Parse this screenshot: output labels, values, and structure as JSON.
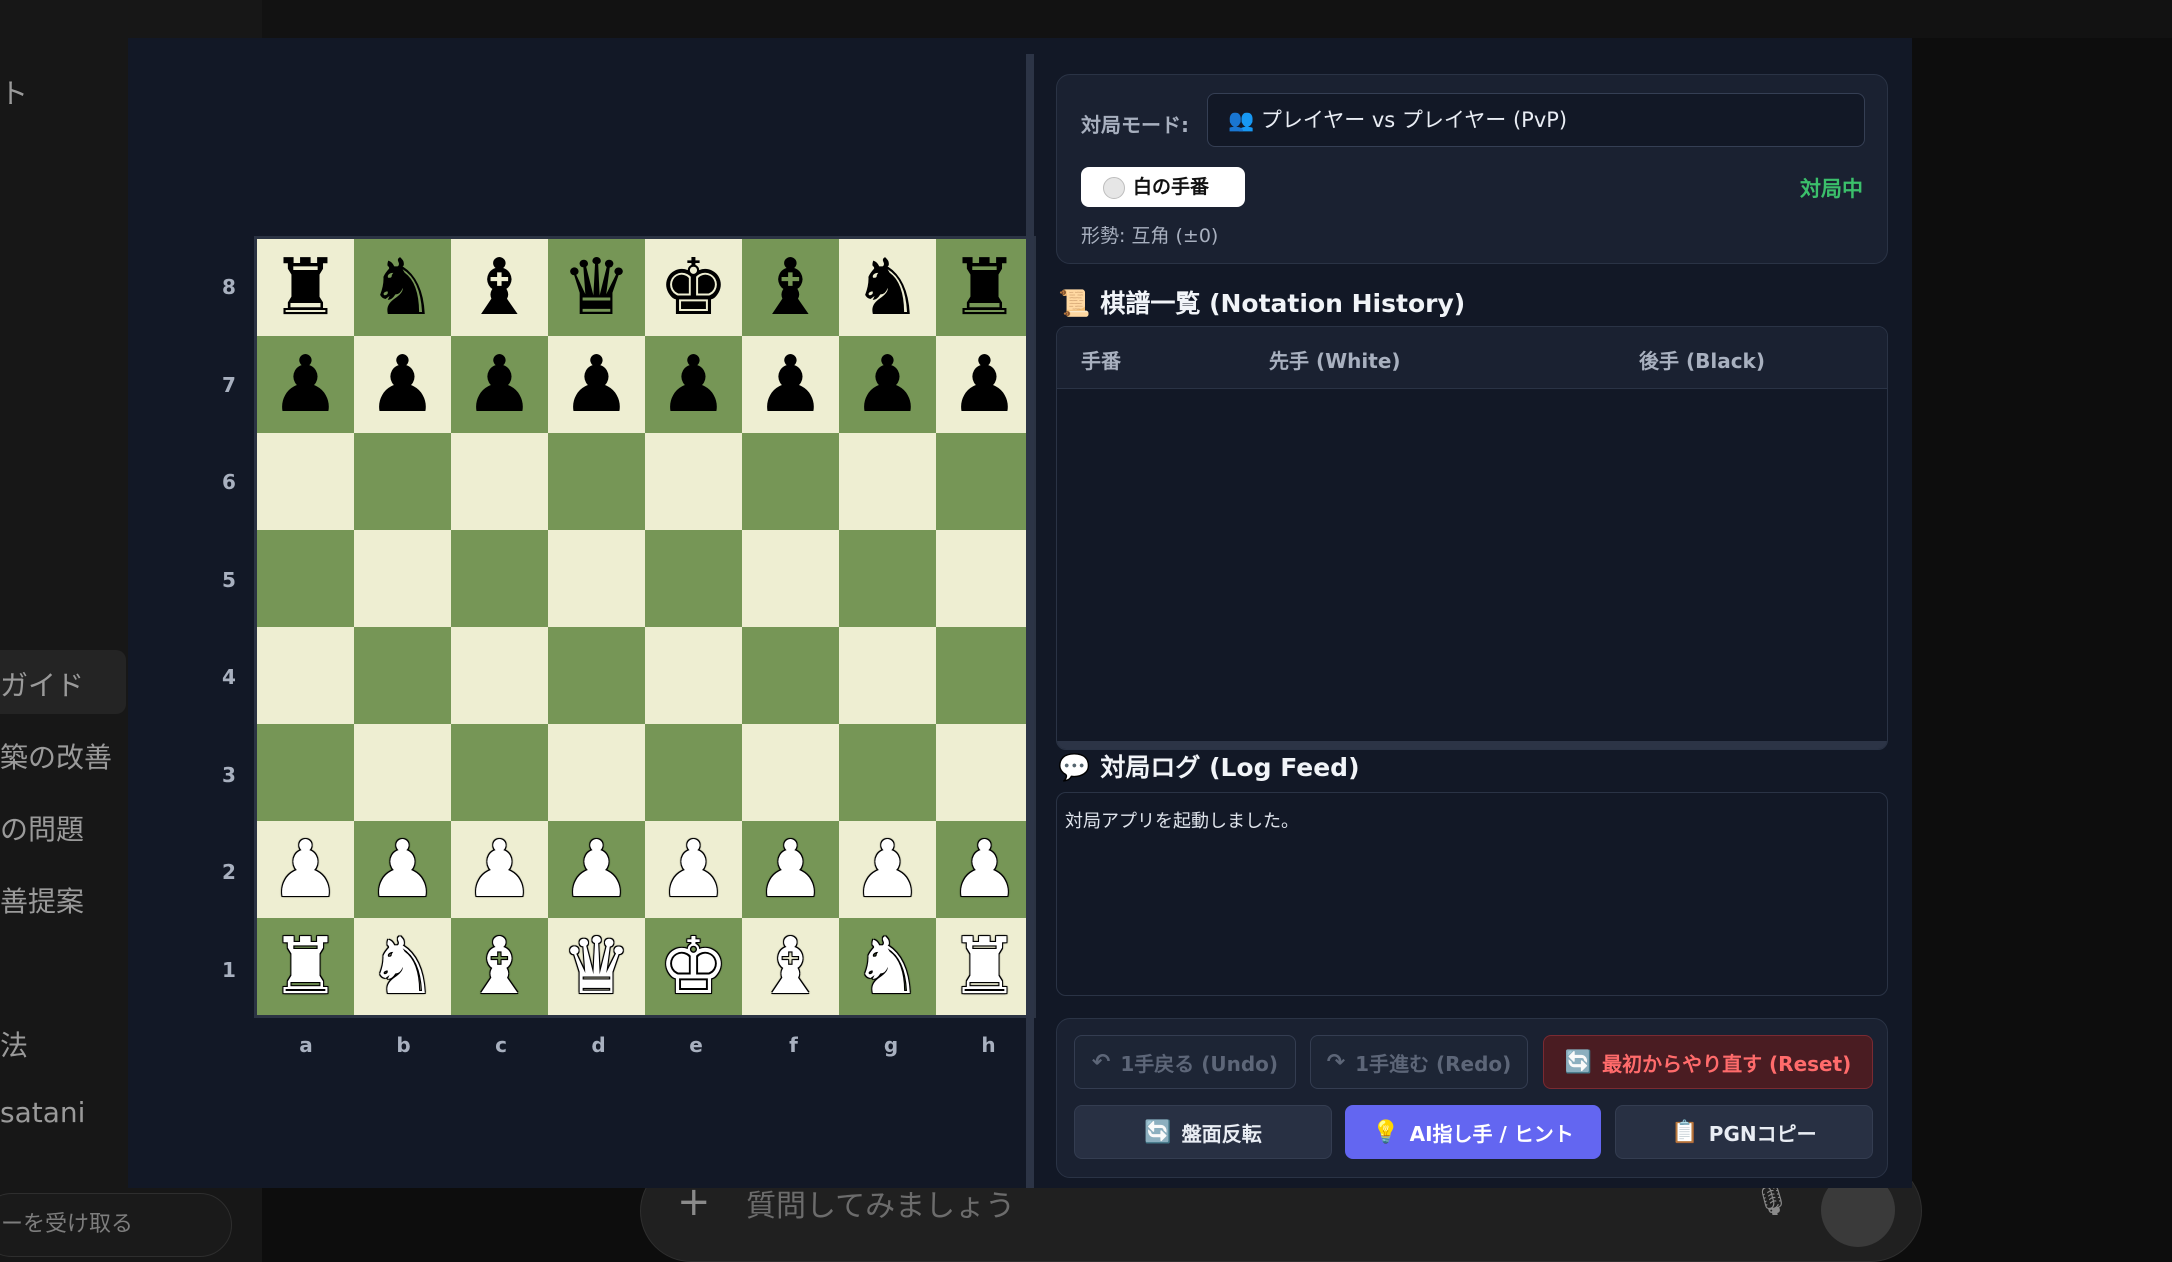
{
  "background": {
    "sidebar_items": [
      "ト",
      "ガイド",
      "築の改善",
      "の問題",
      "善提案",
      "法",
      "satani"
    ],
    "sidebar_bottom": "ーを受け取る",
    "chat_placeholder": "質問してみましょう"
  },
  "board": {
    "ranks": [
      "8",
      "7",
      "6",
      "5",
      "4",
      "3",
      "2",
      "1"
    ],
    "files": [
      "a",
      "b",
      "c",
      "d",
      "e",
      "f",
      "g",
      "h"
    ],
    "position": [
      [
        "br",
        "bn",
        "bb",
        "bq",
        "bk",
        "bb",
        "bn",
        "br"
      ],
      [
        "bp",
        "bp",
        "bp",
        "bp",
        "bp",
        "bp",
        "bp",
        "bp"
      ],
      [
        "",
        "",
        "",
        "",
        "",
        "",
        "",
        ""
      ],
      [
        "",
        "",
        "",
        "",
        "",
        "",
        "",
        ""
      ],
      [
        "",
        "",
        "",
        "",
        "",
        "",
        "",
        ""
      ],
      [
        "",
        "",
        "",
        "",
        "",
        "",
        "",
        ""
      ],
      [
        "wp",
        "wp",
        "wp",
        "wp",
        "wp",
        "wp",
        "wp",
        "wp"
      ],
      [
        "wr",
        "wn",
        "wb",
        "wq",
        "wk",
        "wb",
        "wn",
        "wr"
      ]
    ],
    "colors": {
      "light": "#eeeed2",
      "dark": "#769656"
    }
  },
  "game": {
    "mode_label": "対局モード:",
    "mode_value": "👥 プレイヤー vs プレイヤー (PvP)",
    "turn": "白の手番",
    "status": "対局中",
    "evaluation": "形勢: 互角 (±0)"
  },
  "history": {
    "title": "棋譜一覧 (Notation History)",
    "title_icon": "scroll-icon",
    "columns": [
      "手番",
      "先手 (White)",
      "後手 (Black)"
    ],
    "rows": []
  },
  "log": {
    "title": "対局ログ (Log Feed)",
    "title_icon": "speech-bubble-icon",
    "entries": [
      "対局アプリを起動しました。"
    ]
  },
  "controls": {
    "undo": "1手戻る (Undo)",
    "redo": "1手進む (Redo)",
    "reset": "最初からやり直す (Reset)",
    "flip": "盤面反転",
    "hint": "AI指し手 / ヒント",
    "pgn": "PGNコピー"
  },
  "accent_colors": {
    "primary": "#6366f1",
    "success": "#3bbf6b",
    "danger": "#ff6b6b"
  }
}
